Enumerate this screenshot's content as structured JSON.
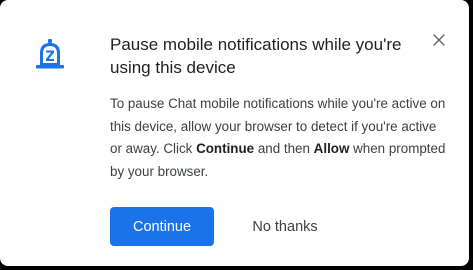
{
  "dialog": {
    "title": "Pause mobile notifications while you're using this device",
    "body": {
      "part1": "To pause Chat mobile notifications while you're active on this device, allow your browser to detect if you're active or away. Click ",
      "bold1": "Continue",
      "part2": " and then ",
      "bold2": "Allow",
      "part3": " when prompted by your browser."
    },
    "continue_label": "Continue",
    "no_thanks_label": "No thanks",
    "close_icon": "close-icon",
    "bell_icon": "notification-bell-icon",
    "accent_color": "#1a73e8"
  }
}
